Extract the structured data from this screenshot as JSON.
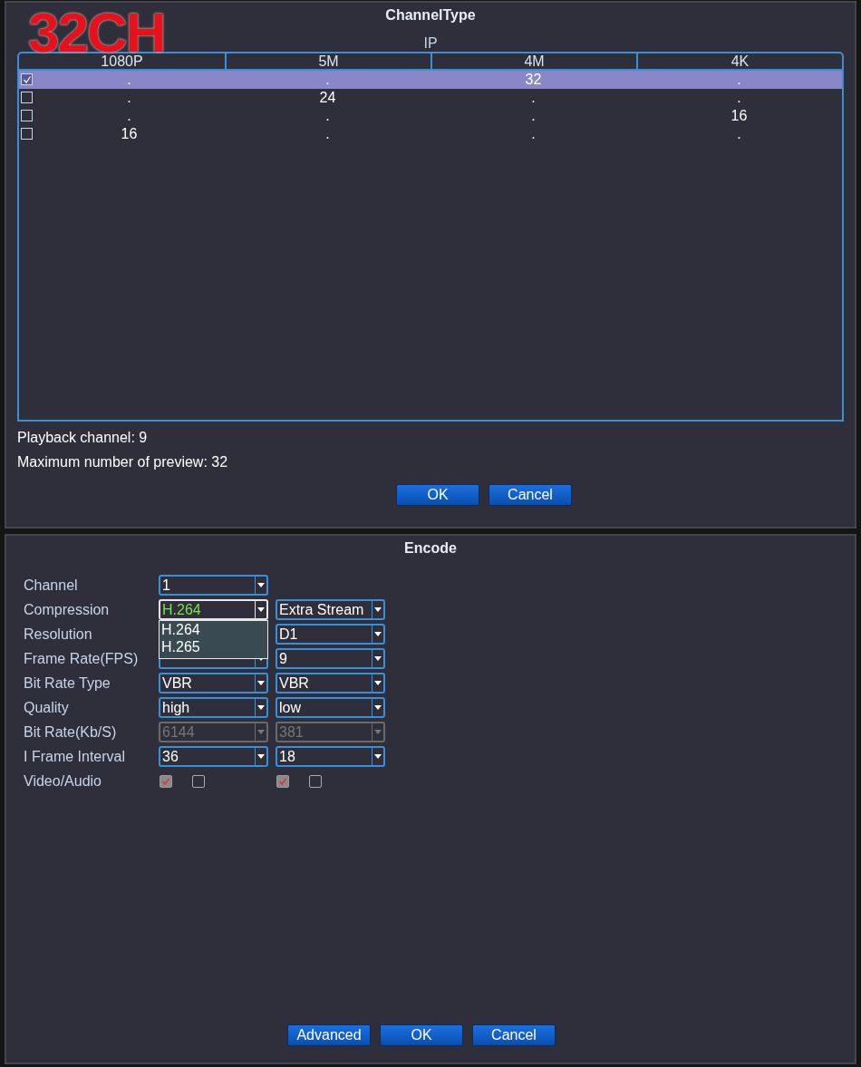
{
  "channel_type": {
    "title": "ChannelType",
    "overlay_label": "32CH",
    "group_label": "IP",
    "columns": [
      "1080P",
      "5M",
      "4M",
      "4K"
    ],
    "rows": [
      {
        "checked": true,
        "selected": true,
        "cells": [
          ".",
          ".",
          "32",
          "."
        ]
      },
      {
        "checked": false,
        "selected": false,
        "cells": [
          ".",
          "24",
          ".",
          "."
        ]
      },
      {
        "checked": false,
        "selected": false,
        "cells": [
          ".",
          ".",
          ".",
          "16"
        ]
      },
      {
        "checked": false,
        "selected": false,
        "cells": [
          "16",
          ".",
          ".",
          "."
        ]
      }
    ],
    "playback_channel": "Playback channel: 9",
    "max_preview": "Maximum number of preview: 32",
    "buttons": [
      {
        "label": "OK"
      },
      {
        "label": "Cancel"
      }
    ]
  },
  "encode": {
    "title": "Encode",
    "rows": [
      {
        "label": "Channel",
        "kind": "select",
        "main": {
          "value": "1",
          "disabled": false,
          "open": false
        }
      },
      {
        "label": "Compression",
        "kind": "select",
        "main": {
          "value": "H.264",
          "disabled": false,
          "open": true,
          "options": [
            "H.264",
            "H.265"
          ]
        },
        "extra": {
          "value": "Extra Stream",
          "disabled": false,
          "open": false
        }
      },
      {
        "label": "Resolution",
        "kind": "select",
        "extra": {
          "value": "D1",
          "disabled": false,
          "open": false
        }
      },
      {
        "label": "Frame Rate(FPS)",
        "kind": "select",
        "main": {
          "disabled": false,
          "open": false
        },
        "extra": {
          "value": "9",
          "disabled": false,
          "open": false
        }
      },
      {
        "label": "Bit Rate Type",
        "kind": "select",
        "main": {
          "value": "VBR",
          "disabled": false,
          "open": false
        },
        "extra": {
          "value": "VBR",
          "disabled": false,
          "open": false
        }
      },
      {
        "label": "Quality",
        "kind": "select",
        "main": {
          "value": "high",
          "disabled": false,
          "open": false
        },
        "extra": {
          "value": "low",
          "disabled": false,
          "open": false
        }
      },
      {
        "label": "Bit Rate(Kb/S)",
        "kind": "select",
        "main": {
          "value": "6144",
          "disabled": true,
          "open": false
        },
        "extra": {
          "value": "381",
          "disabled": true,
          "open": false
        }
      },
      {
        "label": "I Frame Interval",
        "kind": "select",
        "main": {
          "value": "36",
          "disabled": false,
          "open": false
        },
        "extra": {
          "value": "18",
          "disabled": false,
          "open": false
        }
      },
      {
        "label": "Video/Audio",
        "kind": "checks",
        "main": [
          {
            "checked": true
          },
          {
            "checked": false
          }
        ],
        "extra": [
          {
            "checked": true
          },
          {
            "checked": false
          }
        ]
      }
    ],
    "buttons": [
      {
        "label": "Advanced"
      },
      {
        "label": "OK"
      },
      {
        "label": "Cancel"
      }
    ]
  }
}
